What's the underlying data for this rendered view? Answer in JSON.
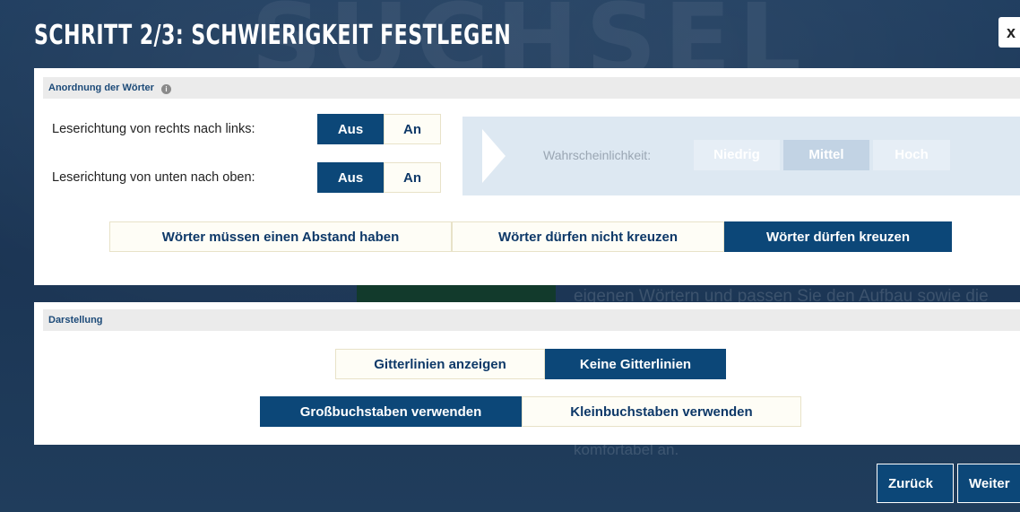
{
  "dialog": {
    "title": "SCHRITT 2/3: SCHWIERIGKEIT FESTLEGEN",
    "close_label": "x"
  },
  "arrangement": {
    "heading": "Anordnung der Wörter",
    "info_icon": "info-icon",
    "rtl_label": "Leserichtung von rechts nach links:",
    "rtl_options": [
      "Aus",
      "An"
    ],
    "rtl_selected": "Aus",
    "btt_label": "Leserichtung von unten nach oben:",
    "btt_options": [
      "Aus",
      "An"
    ],
    "btt_selected": "Aus",
    "probability_label": "Wahrscheinlichkeit:",
    "probability_options": [
      "Niedrig",
      "Mittel",
      "Hoch"
    ],
    "probability_selected": "Mittel",
    "crossing_options": [
      "Wörter müssen einen Abstand haben",
      "Wörter dürfen nicht kreuzen",
      "Wörter dürfen kreuzen"
    ],
    "crossing_selected": "Wörter dürfen kreuzen"
  },
  "display": {
    "heading": "Darstellung",
    "grid_options": [
      "Gitterlinien anzeigen",
      "Keine Gitterlinien"
    ],
    "grid_selected": "Keine Gitterlinien",
    "case_options": [
      "Großbuchstaben verwenden",
      "Kleinbuchstaben verwenden"
    ],
    "case_selected": "Großbuchstaben verwenden"
  },
  "footer": {
    "back_label": "Zurück",
    "next_label": "Weiter"
  },
  "colors": {
    "primary": "#0c4778",
    "background": "#1e3a5a",
    "inactive_button": "#fefdf6"
  }
}
